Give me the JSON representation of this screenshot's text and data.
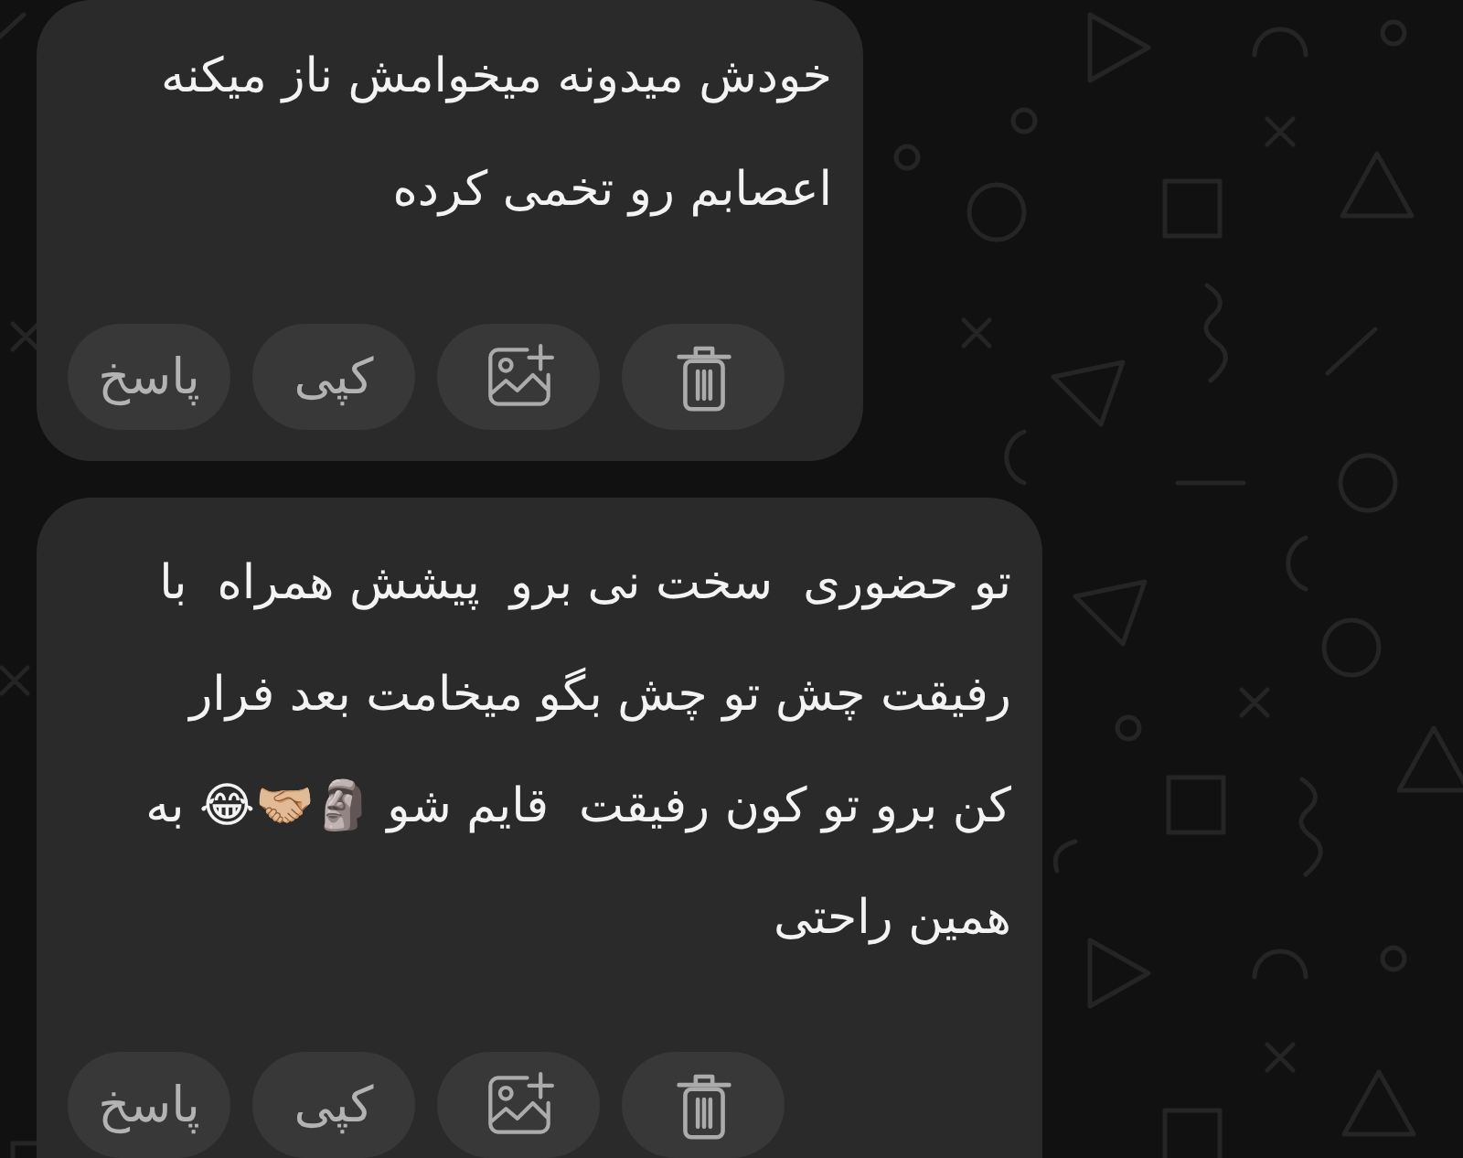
{
  "messages": [
    {
      "lines": [
        "خودش میدونه میخوامش ناز میکنه",
        "اعصابم رو تخمی کرده"
      ],
      "actions": [
        {
          "kind": "delete"
        },
        {
          "kind": "add_image"
        },
        {
          "kind": "copy",
          "label": "کپی"
        },
        {
          "kind": "reply",
          "label": "پاسخ"
        }
      ]
    },
    {
      "lines": [
        "تو حضوری  سخت نی برو  پیشش همراه  با",
        "رفیقت چش تو چش بگو میخامت بعد فرار",
        "کن برو تو کون رفیقت  قایم شو 🗿🤝🏼😂 به",
        "همین راحتی"
      ],
      "actions": [
        {
          "kind": "delete"
        },
        {
          "kind": "add_image"
        },
        {
          "kind": "copy",
          "label": "کپی"
        },
        {
          "kind": "reply",
          "label": "پاسخ"
        }
      ]
    }
  ]
}
